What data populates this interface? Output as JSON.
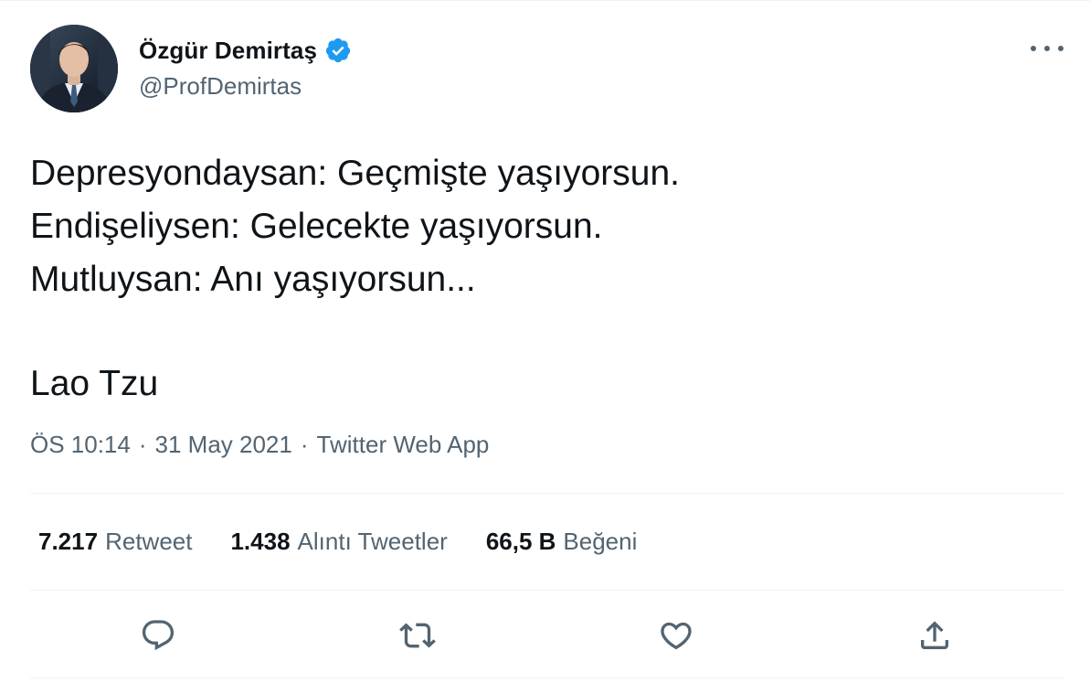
{
  "author": {
    "display_name": "Özgür Demirtaş",
    "handle": "@ProfDemirtas",
    "avatar_icon": "profile-photo",
    "verified_icon": "verified-badge-icon",
    "verified_color": "#1d9bf0"
  },
  "more_icon": "more-options-icon",
  "tweet": {
    "lines": [
      "Depresyondaysan: Geçmişte yaşıyorsun.",
      "Endişeliysen: Gelecekte yaşıyorsun.",
      "Mutluysan: Anı yaşıyorsun..."
    ],
    "signature": "Lao Tzu"
  },
  "meta": {
    "time": "ÖS 10:14",
    "separator": "·",
    "date": "31 May 2021",
    "source": "Twitter Web App"
  },
  "stats": {
    "retweets": {
      "count": "7.217",
      "label": "Retweet"
    },
    "quotes": {
      "count": "1.438",
      "label": "Alıntı Tweetler"
    },
    "likes": {
      "count": "66,5 B",
      "label": "Beğeni"
    }
  },
  "actions": {
    "reply_icon": "reply-icon",
    "retweet_icon": "retweet-icon",
    "like_icon": "heart-icon",
    "share_icon": "share-icon",
    "icon_color": "#536471"
  },
  "colors": {
    "text_primary": "#0f1419",
    "text_secondary": "#536471",
    "divider": "#eff3f4",
    "accent": "#1d9bf0"
  }
}
